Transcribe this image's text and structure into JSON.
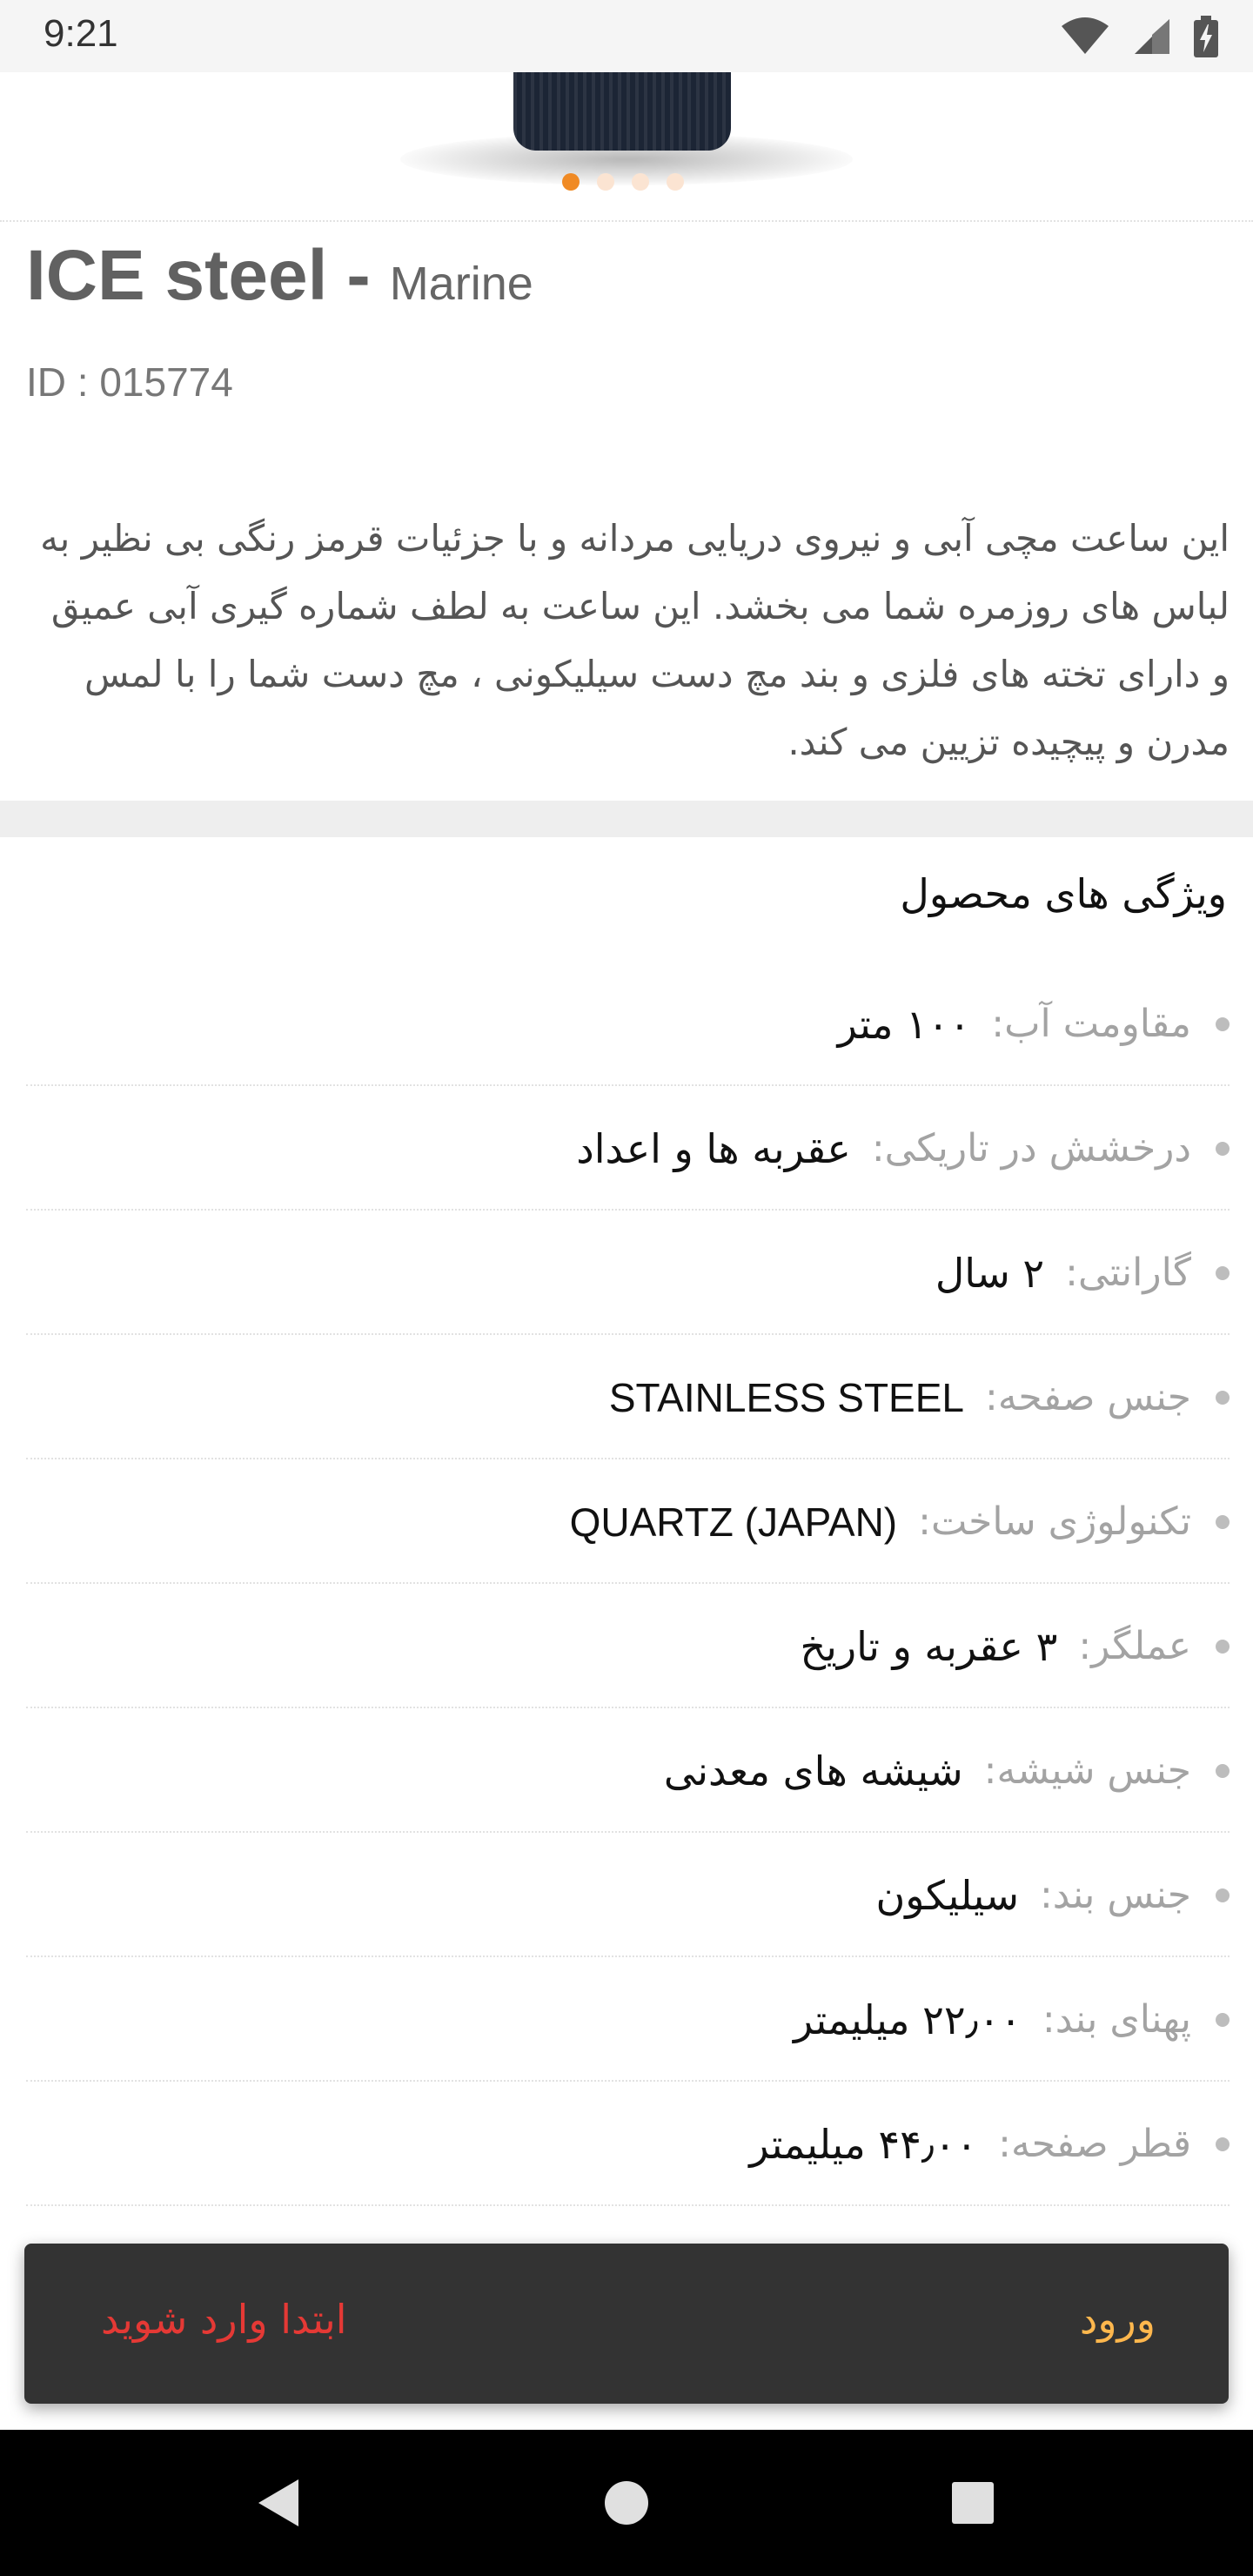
{
  "status_bar": {
    "time": "9:21",
    "icons": [
      "wifi-icon",
      "signal-icon",
      "battery-charging-icon"
    ]
  },
  "gallery": {
    "dot_count": 4,
    "active_index": 0,
    "accent_color": "#f08a24"
  },
  "product": {
    "name": "ICE steel",
    "dash": "-",
    "variant": "Marine",
    "id_text": "ID : 015774",
    "description": "این ساعت مچی آبی و نیروی دریایی مردانه و با جزئیات قرمز رنگی بی نظیر به لباس های روزمره شما می بخشد. این ساعت به لطف شماره گیری آبی عمیق و دارای تخته های فلزی و بند مچ دست سیلیکونی ، مچ دست شما را با لمس مدرن و پیچیده تزیین می کند."
  },
  "features": {
    "title": "ویژگی های محصول",
    "items": [
      {
        "label": "مقاومت آب:",
        "value": "۱۰۰ متر"
      },
      {
        "label": "درخشش در تاریکی:",
        "value": "عقربه ها و اعداد"
      },
      {
        "label": "گارانتی:",
        "value": "۲ سال"
      },
      {
        "label": "جنس صفحه:",
        "value": "STAINLESS STEEL"
      },
      {
        "label": "تکنولوژی ساخت:",
        "value": "QUARTZ (JAPAN)"
      },
      {
        "label": "عملگر:",
        "value": "۳ عقربه و تاریخ"
      },
      {
        "label": "جنس شیشه:",
        "value": "شیشه های معدنی"
      },
      {
        "label": "جنس بند:",
        "value": "سیلیکون"
      },
      {
        "label": "پهنای بند:",
        "value": "۲۲٫۰۰ میلیمتر"
      },
      {
        "label": "قطر صفحه:",
        "value": "۴۴٫۰۰ میلیمتر"
      }
    ]
  },
  "snackbar": {
    "message": "ابتدا وارد شوید",
    "action": "ورود",
    "message_color": "#e53935",
    "action_color": "#ffb74d"
  },
  "nav_bar": {
    "icons": [
      "back-icon",
      "home-icon",
      "recents-icon"
    ]
  }
}
